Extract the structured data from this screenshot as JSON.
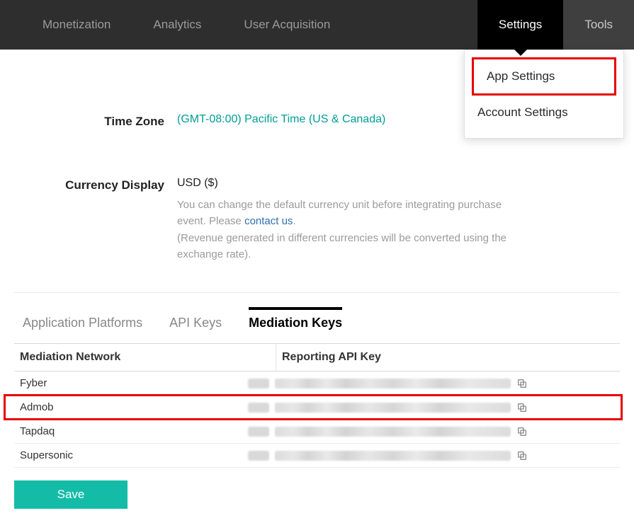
{
  "nav": {
    "items": [
      "Monetization",
      "Analytics",
      "User Acquisition",
      "Settings",
      "Tools"
    ],
    "active_index": 3
  },
  "dropdown": {
    "items": [
      "App Settings",
      "Account Settings"
    ],
    "highlight_index": 0
  },
  "form": {
    "timezone": {
      "label": "Time Zone",
      "value": "(GMT-08:00) Pacific Time (US & Canada)"
    },
    "currency": {
      "label": "Currency Display",
      "value": "USD ($)",
      "hint_pre": "You can change the default currency unit before integrating purchase event. Please ",
      "hint_link": "contact us",
      "hint_post": ".",
      "hint_note": "(Revenue generated in different currencies will be converted using the exchange rate)."
    }
  },
  "tabs": {
    "items": [
      "Application Platforms",
      "API Keys",
      "Mediation Keys"
    ],
    "active_index": 2
  },
  "table": {
    "head": {
      "col1": "Mediation Network",
      "col2": "Reporting API Key"
    },
    "rows": [
      {
        "network": "Fyber"
      },
      {
        "network": "Admob"
      },
      {
        "network": "Tapdaq"
      },
      {
        "network": "Supersonic"
      }
    ],
    "highlight_index": 1
  },
  "actions": {
    "save": "Save"
  }
}
